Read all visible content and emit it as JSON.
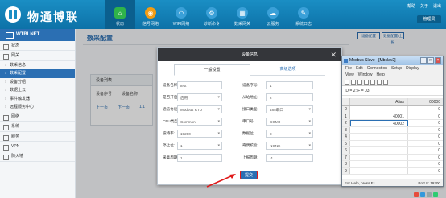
{
  "app": {
    "brand": "物通博联",
    "top_links": [
      "帮助",
      "关于",
      "退出"
    ],
    "user": "管理员"
  },
  "nav": [
    {
      "label": "状态",
      "icon": "home-icon",
      "active": true
    },
    {
      "label": "信号网络",
      "icon": "signal-icon",
      "active": false
    },
    {
      "label": "WIFI网络",
      "icon": "wifi-icon",
      "active": false
    },
    {
      "label": "诊断命令",
      "icon": "network-icon",
      "active": false
    },
    {
      "label": "数采网关",
      "icon": "gateway-icon",
      "active": false
    },
    {
      "label": "云服务",
      "icon": "cloud-icon",
      "active": false
    },
    {
      "label": "系统日志",
      "icon": "log-icon",
      "active": false
    }
  ],
  "sidebar": {
    "title": "WTBLNET",
    "items": [
      {
        "label": "状态"
      },
      {
        "label": "网关"
      }
    ],
    "sub_items": [
      {
        "label": "数采信息",
        "active": false
      },
      {
        "label": "数采配置",
        "active": true
      },
      {
        "label": "设备分组",
        "active": false
      },
      {
        "label": "数据上云",
        "active": false
      },
      {
        "label": "事件触发器",
        "active": false
      },
      {
        "label": "远程服务中心",
        "active": false
      }
    ],
    "bottom_items": [
      {
        "label": "网络"
      },
      {
        "label": "系统"
      },
      {
        "label": "服务"
      },
      {
        "label": "VPN"
      },
      {
        "label": "防火墙"
      }
    ]
  },
  "main": {
    "page_title": "数采配置",
    "card": {
      "title": "设备列表",
      "col1": "设备序号",
      "col2": "设备名称",
      "links": [
        "上一页",
        "下一页"
      ],
      "page_num": "1/1"
    },
    "right_buttons": [
      "设备配置",
      "数据配置/上报"
    ]
  },
  "dialog": {
    "title": "设备信息",
    "close": "✕",
    "tabs": [
      {
        "label": "一般设置",
        "active": true
      },
      {
        "label": "高级选项",
        "active": false
      }
    ],
    "fields_left": [
      {
        "label": "设备名称:",
        "value": "test",
        "type": "text"
      },
      {
        "label": "是否开启:",
        "value": "启用",
        "type": "select"
      },
      {
        "label": "通信协议:",
        "value": "Modbus RTU",
        "type": "select"
      },
      {
        "label": "CPU类型:",
        "value": "Common",
        "type": "select"
      },
      {
        "label": "波特率:",
        "value": "19200",
        "type": "select"
      },
      {
        "label": "停止位:",
        "value": "1",
        "type": "select"
      },
      {
        "label": "采集周期:",
        "value": "1",
        "type": "text"
      }
    ],
    "fields_right": [
      {
        "label": "设备序号:",
        "value": "1",
        "type": "text"
      },
      {
        "label": "从站地址:",
        "value": "2",
        "type": "text"
      },
      {
        "label": "接口类型:",
        "value": "485串口",
        "type": "select"
      },
      {
        "label": "串口号:",
        "value": "COM0",
        "type": "select"
      },
      {
        "label": "数据位:",
        "value": "8",
        "type": "select"
      },
      {
        "label": "奇偶校验:",
        "value": "NONE",
        "type": "select"
      },
      {
        "label": "上报周期:",
        "value": "-1",
        "type": "text"
      }
    ],
    "submit": "提交"
  },
  "modbus": {
    "title": "Modbus Slave - [Mbslav2]",
    "menu1": [
      "File",
      "Edit",
      "Connection",
      "Setup",
      "Display"
    ],
    "menu2": [
      "View",
      "Window",
      "Help"
    ],
    "id_line": "ID = 2: F = 03",
    "headers": [
      "",
      "Alias",
      "00000"
    ],
    "rows": [
      {
        "idx": "0",
        "alias": "",
        "value": "0",
        "selected": false
      },
      {
        "idx": "1",
        "alias": "40001",
        "value": "0",
        "selected": false
      },
      {
        "idx": "2",
        "alias": "40002",
        "value": "0",
        "selected": true
      },
      {
        "idx": "3",
        "alias": "",
        "value": "0",
        "selected": false
      },
      {
        "idx": "4",
        "alias": "",
        "value": "0",
        "selected": false
      },
      {
        "idx": "5",
        "alias": "",
        "value": "0",
        "selected": false
      },
      {
        "idx": "6",
        "alias": "",
        "value": "0",
        "selected": false
      },
      {
        "idx": "7",
        "alias": "",
        "value": "0",
        "selected": false
      },
      {
        "idx": "8",
        "alias": "",
        "value": "0",
        "selected": false
      },
      {
        "idx": "9",
        "alias": "",
        "value": "0",
        "selected": false
      }
    ],
    "status_left": "For Help, press F1.",
    "status_right": "Port 8: 19200"
  },
  "colors": {
    "header_blue": "#1a8ec4",
    "accent_blue": "#2b6fb3",
    "dialog_header": "#34363a",
    "highlight_red": "#e01a1a"
  }
}
